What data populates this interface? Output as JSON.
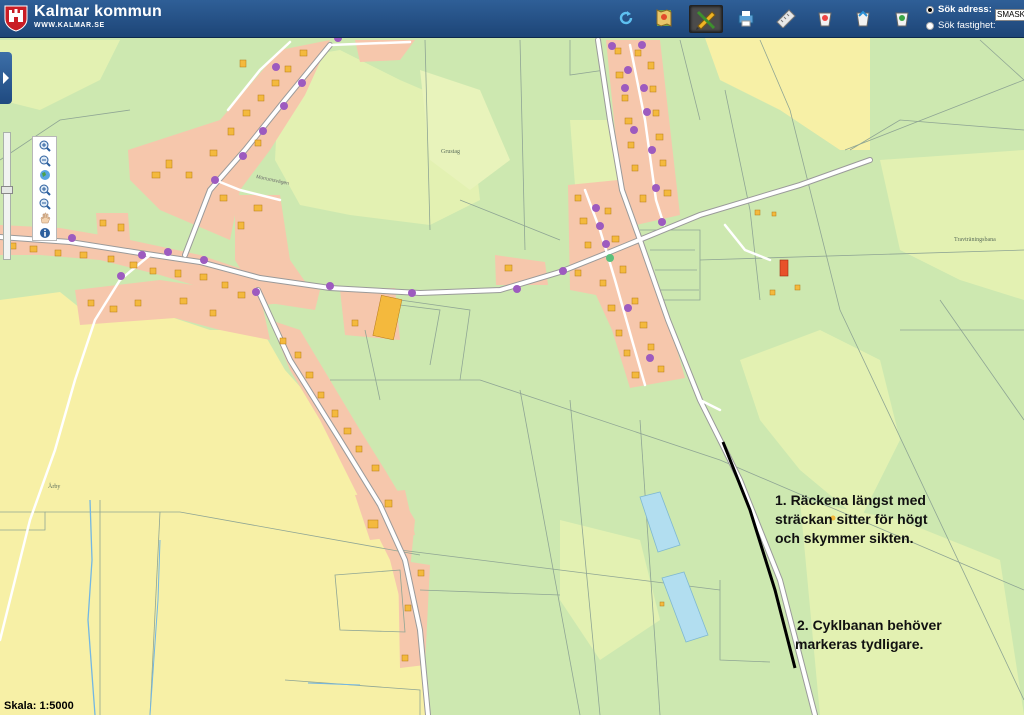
{
  "header": {
    "brand": "Kalmar kommun",
    "brand_url": "WWW.KALMAR.SE",
    "tools": [
      {
        "name": "refresh-icon",
        "active": false
      },
      {
        "name": "map-layers-icon",
        "active": false
      },
      {
        "name": "draw-tools-icon",
        "active": true
      },
      {
        "name": "print-icon",
        "active": false
      },
      {
        "name": "ruler-icon",
        "active": false
      },
      {
        "name": "bucket-icon-1",
        "active": false
      },
      {
        "name": "bucket-icon-2",
        "active": false
      },
      {
        "name": "bucket-icon-3",
        "active": false
      }
    ],
    "search": {
      "option_address": "Sök adress:",
      "option_property": "Sök fastighet:",
      "selected": "address",
      "input_value": "SMASK"
    }
  },
  "map": {
    "labels": {
      "grustag": "Grustag",
      "travtraningsbana": "Travträningsbana",
      "arby": "Årby",
      "road_small": "Morrumsvägen"
    },
    "annotations": {
      "note1_line1": "1. Räckena längst med",
      "note1_line2": "sträckan sitter för högt",
      "note1_line3": "och skymmer sikten.",
      "note2_line1": "2. Cyklbanan behöver",
      "note2_line2": "markeras tydligare."
    },
    "colors": {
      "farmland": "#f7f0a6",
      "grass": "#cde8b0",
      "forest_light": "#e3f1b2",
      "residential": "#f6c7ac",
      "building": "#f4b93d",
      "road": "#ffffff",
      "stop": "#9d5bbf",
      "water": "#b2def0",
      "highlight": "#000000"
    },
    "scale": "Skala: 1:5000"
  },
  "zoom_controls": [
    {
      "name": "zoom-in-icon"
    },
    {
      "name": "zoom-out-icon"
    },
    {
      "name": "globe-icon"
    },
    {
      "name": "zoom-box-in-icon"
    },
    {
      "name": "zoom-box-out-icon"
    },
    {
      "name": "pan-hand-icon"
    },
    {
      "name": "info-icon"
    }
  ]
}
